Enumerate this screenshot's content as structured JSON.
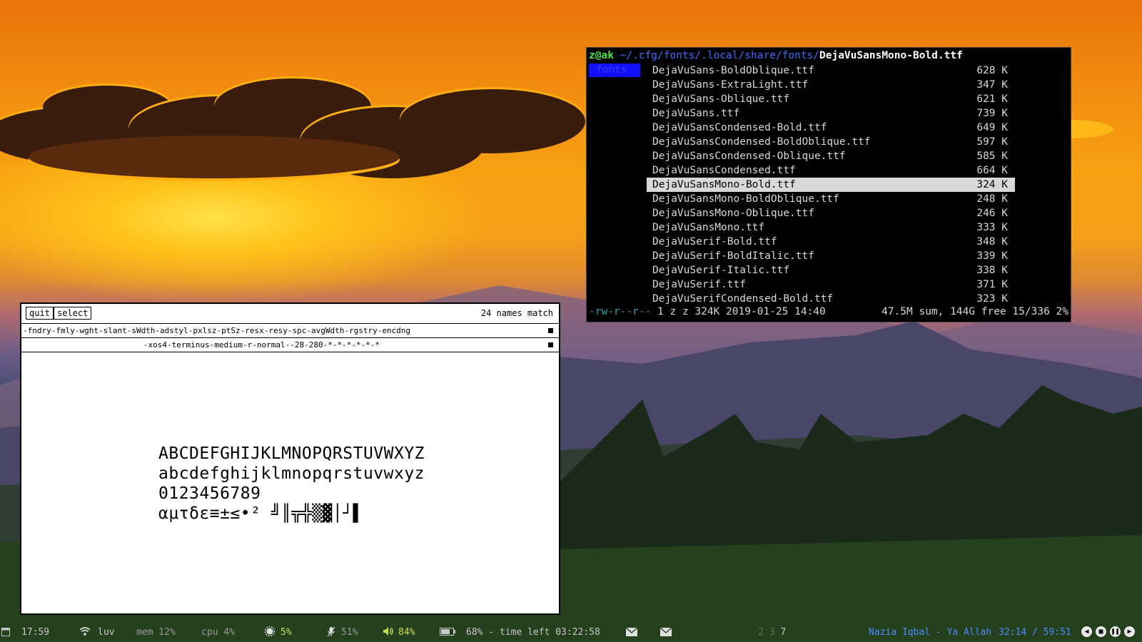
{
  "xfontsel": {
    "quit_label": "quit",
    "select_label": "select",
    "match_count": "24 names match",
    "pattern": "-fndry-fmly-wght-slant-sWdth-adstyl-pxlsz-ptSz-resx-resy-spc-avgWdth-rgstry-encdng",
    "current_font": "-xos4-terminus-medium-r-normal--28-280-*-*-*-*-*-*",
    "sample": {
      "line1": "ABCDEFGHIJKLMNOPQRSTUVWXYZ",
      "line2": "abcdefghijklmnopqrstuvwxyz",
      "line3": "0123456789",
      "line4": "αμτδε≡±≤•² ╝║╦╬▒▓│┘▌"
    }
  },
  "terminal": {
    "prompt_user": "z@ak",
    "prompt_path": " ~/.cfg/fonts/.local/share/fonts/",
    "prompt_file": "DejaVuSansMono-Bold.ttf",
    "parent_dir": "fonts",
    "files": [
      {
        "name": "DejaVuSans-BoldOblique.ttf",
        "size": "628 K"
      },
      {
        "name": "DejaVuSans-ExtraLight.ttf",
        "size": "347 K"
      },
      {
        "name": "DejaVuSans-Oblique.ttf",
        "size": "621 K"
      },
      {
        "name": "DejaVuSans.ttf",
        "size": "739 K"
      },
      {
        "name": "DejaVuSansCondensed-Bold.ttf",
        "size": "649 K"
      },
      {
        "name": "DejaVuSansCondensed-BoldOblique.ttf",
        "size": "597 K"
      },
      {
        "name": "DejaVuSansCondensed-Oblique.ttf",
        "size": "585 K"
      },
      {
        "name": "DejaVuSansCondensed.ttf",
        "size": "664 K"
      },
      {
        "name": "DejaVuSansMono-Bold.ttf",
        "size": "324 K"
      },
      {
        "name": "DejaVuSansMono-BoldOblique.ttf",
        "size": "248 K"
      },
      {
        "name": "DejaVuSansMono-Oblique.ttf",
        "size": "246 K"
      },
      {
        "name": "DejaVuSansMono.ttf",
        "size": "333 K"
      },
      {
        "name": "DejaVuSerif-Bold.ttf",
        "size": "348 K"
      },
      {
        "name": "DejaVuSerif-BoldItalic.ttf",
        "size": "339 K"
      },
      {
        "name": "DejaVuSerif-Italic.ttf",
        "size": "338 K"
      },
      {
        "name": "DejaVuSerif.ttf",
        "size": "371 K"
      },
      {
        "name": "DejaVuSerifCondensed-Bold.ttf",
        "size": "323 K"
      }
    ],
    "selected_index": 8,
    "status_perm": "-rw-r--r--",
    "status_info": " 1 z z 324K 2019-01-25 14:40",
    "status_right": "47.5M sum, 144G free  15/336  2%"
  },
  "statusbar": {
    "time": "17:59",
    "wifi": "luv",
    "mem": "mem 12%",
    "cpu": "cpu 4%",
    "brightness": "5%",
    "mic": "51%",
    "volume": "84%",
    "battery": "68% - time left 03:22:58",
    "workspaces_dim": "2 3",
    "workspace_active": "7",
    "now_playing": "Nazia Iqbal - Ya Allah",
    "playback_time": "32:14 / 59:51",
    "colors": {
      "accent_green": "#c8e04a",
      "accent_blue": "#4a8cff"
    },
    "icons": [
      "calendar-icon",
      "wifi-icon",
      "gear-icon",
      "mic-icon",
      "volume-icon",
      "battery-icon",
      "mail-icon",
      "prev-icon",
      "stop-icon",
      "pause-icon",
      "next-icon"
    ]
  }
}
